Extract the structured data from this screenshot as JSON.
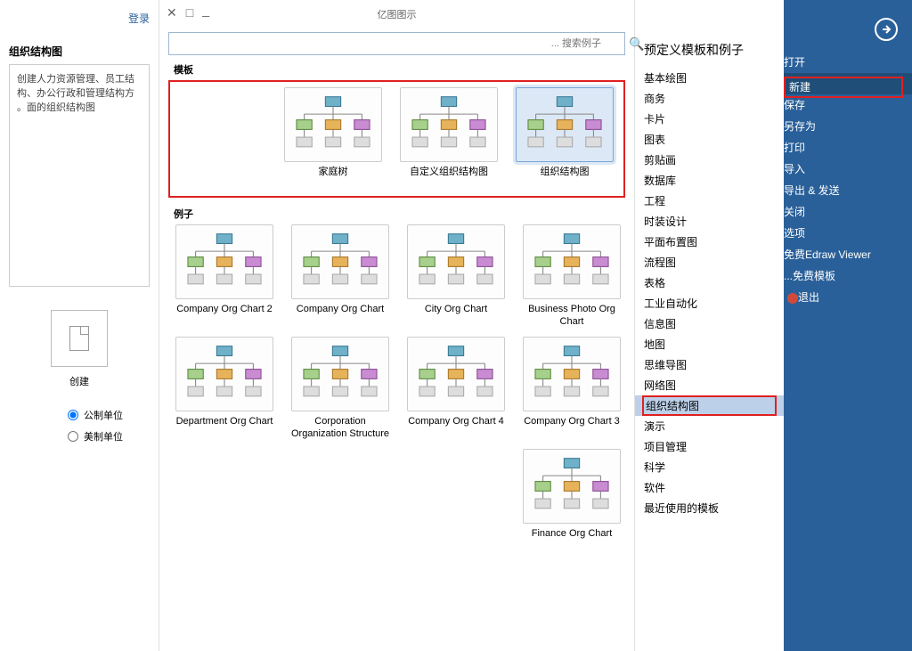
{
  "titlebar": {
    "appname": "亿图图示"
  },
  "login_text": "登录",
  "rail": {
    "items": [
      {
        "label": "打开"
      },
      {
        "label": "新建",
        "selected": true,
        "red": true
      },
      {
        "label": "保存"
      },
      {
        "label": "另存为"
      },
      {
        "label": "打印"
      },
      {
        "label": "导入"
      },
      {
        "label": "导出 & 发送"
      },
      {
        "label": "关闭"
      },
      {
        "label": "选项"
      },
      {
        "label": "免费Edraw Viewer"
      },
      {
        "label": "免费模板..."
      },
      {
        "label": "退出",
        "exit": true
      }
    ]
  },
  "categories": {
    "heading": "预定义模板和例子",
    "items": [
      {
        "label": "基本绘图"
      },
      {
        "label": "商务"
      },
      {
        "label": "卡片"
      },
      {
        "label": "图表"
      },
      {
        "label": "剪贴画"
      },
      {
        "label": "数据库"
      },
      {
        "label": "工程"
      },
      {
        "label": "时装设计"
      },
      {
        "label": "平面布置图"
      },
      {
        "label": "流程图"
      },
      {
        "label": "表格"
      },
      {
        "label": "工业自动化"
      },
      {
        "label": "信息图"
      },
      {
        "label": "地图"
      },
      {
        "label": "思维导图"
      },
      {
        "label": "网络图"
      },
      {
        "label": "组织结构图",
        "selected": true,
        "red": true
      },
      {
        "label": "演示"
      },
      {
        "label": "项目管理"
      },
      {
        "label": "科学"
      },
      {
        "label": "软件"
      },
      {
        "label": "最近使用的模板"
      }
    ]
  },
  "search": {
    "placeholder": "搜索例子 ..."
  },
  "gallery": {
    "section_templates_label": "模板",
    "section_examples_label": "例子",
    "templates": [
      {
        "label": "组织结构图",
        "selected": true
      },
      {
        "label": "自定义组织结构图"
      },
      {
        "label": "家庭树"
      }
    ],
    "examples": [
      {
        "label": "Business Photo Org Chart"
      },
      {
        "label": "City Org Chart"
      },
      {
        "label": "Company Org Chart"
      },
      {
        "label": "Company Org Chart 2"
      },
      {
        "label": "Company Org Chart 3"
      },
      {
        "label": "Company Org Chart 4"
      },
      {
        "label": "Corporation Organization Structure"
      },
      {
        "label": "Department Org Chart"
      },
      {
        "label": "Finance Org Chart"
      }
    ]
  },
  "preview": {
    "title": "组织结构图",
    "desc": "创建人力资源管理、员工结构、办公行政和管理结构方面的组织结构图。",
    "create_label": "创建",
    "radios": [
      {
        "label": "公制单位",
        "checked": true
      },
      {
        "label": "美制单位",
        "checked": false
      }
    ]
  }
}
